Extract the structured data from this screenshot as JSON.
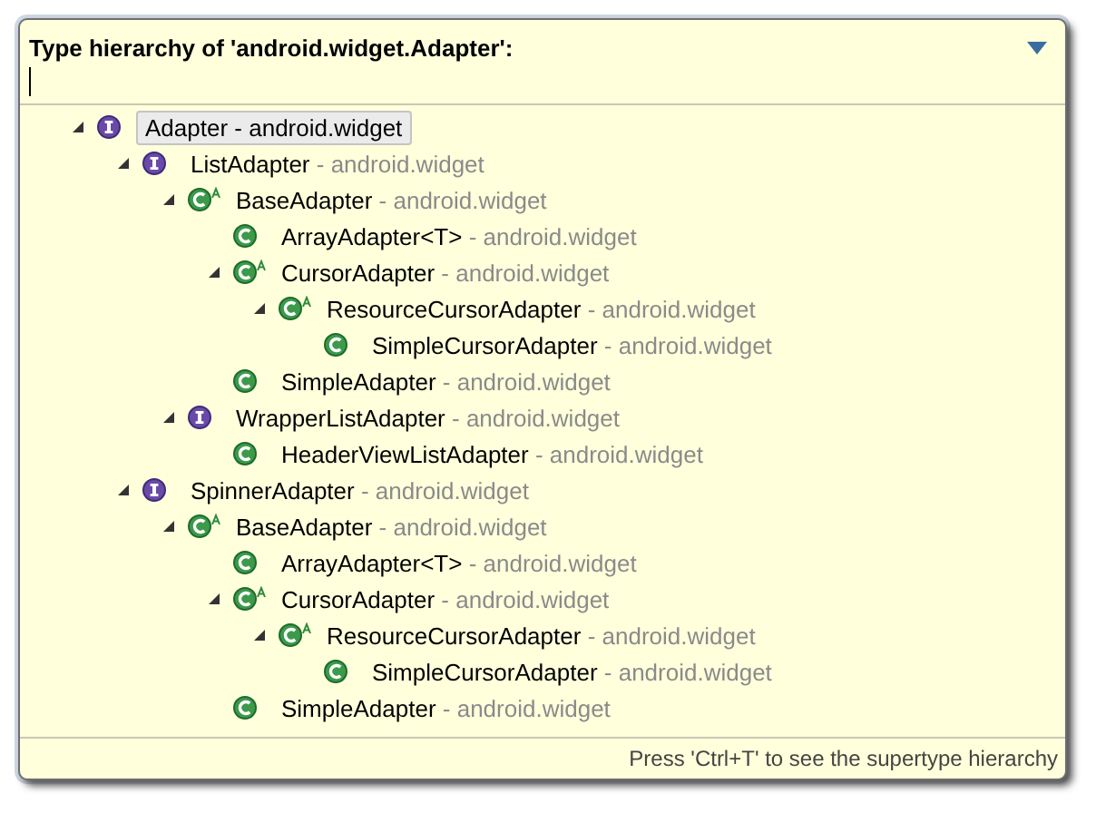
{
  "popup": {
    "title": "Type hierarchy of 'android.widget.Adapter':",
    "tree": [
      {
        "name": "Adapter",
        "package": "- android.widget",
        "kind": "interface",
        "expanded": true,
        "selected": true,
        "children": [
          {
            "name": "ListAdapter",
            "package": "- android.widget",
            "kind": "interface",
            "expanded": true,
            "selected": false,
            "children": [
              {
                "name": "BaseAdapter",
                "package": "- android.widget",
                "kind": "class",
                "abstract": true,
                "expanded": true,
                "selected": false,
                "children": [
                  {
                    "name": "ArrayAdapter<T>",
                    "package": "- android.widget",
                    "kind": "class",
                    "selected": false
                  },
                  {
                    "name": "CursorAdapter",
                    "package": "- android.widget",
                    "kind": "class",
                    "abstract": true,
                    "expanded": true,
                    "selected": false,
                    "children": [
                      {
                        "name": "ResourceCursorAdapter",
                        "package": "- android.widget",
                        "kind": "class",
                        "abstract": true,
                        "expanded": true,
                        "selected": false,
                        "children": [
                          {
                            "name": "SimpleCursorAdapter",
                            "package": "- android.widget",
                            "kind": "class",
                            "selected": false
                          }
                        ]
                      }
                    ]
                  },
                  {
                    "name": "SimpleAdapter",
                    "package": "- android.widget",
                    "kind": "class",
                    "selected": false
                  }
                ]
              },
              {
                "name": "WrapperListAdapter",
                "package": "- android.widget",
                "kind": "interface",
                "expanded": true,
                "selected": false,
                "children": [
                  {
                    "name": "HeaderViewListAdapter",
                    "package": "- android.widget",
                    "kind": "class",
                    "selected": false
                  }
                ]
              }
            ]
          },
          {
            "name": "SpinnerAdapter",
            "package": "- android.widget",
            "kind": "interface",
            "expanded": true,
            "selected": false,
            "children": [
              {
                "name": "BaseAdapter",
                "package": "- android.widget",
                "kind": "class",
                "abstract": true,
                "expanded": true,
                "selected": false,
                "children": [
                  {
                    "name": "ArrayAdapter<T>",
                    "package": "- android.widget",
                    "kind": "class",
                    "selected": false
                  },
                  {
                    "name": "CursorAdapter",
                    "package": "- android.widget",
                    "kind": "class",
                    "abstract": true,
                    "expanded": true,
                    "selected": false,
                    "children": [
                      {
                        "name": "ResourceCursorAdapter",
                        "package": "- android.widget",
                        "kind": "class",
                        "abstract": true,
                        "expanded": true,
                        "selected": false,
                        "children": [
                          {
                            "name": "SimpleCursorAdapter",
                            "package": "- android.widget",
                            "kind": "class",
                            "selected": false
                          }
                        ]
                      }
                    ]
                  },
                  {
                    "name": "SimpleAdapter",
                    "package": "- android.widget",
                    "kind": "class",
                    "selected": false
                  }
                ]
              }
            ]
          }
        ]
      }
    ],
    "status_hint": "Press 'Ctrl+T' to see the supertype hierarchy"
  }
}
